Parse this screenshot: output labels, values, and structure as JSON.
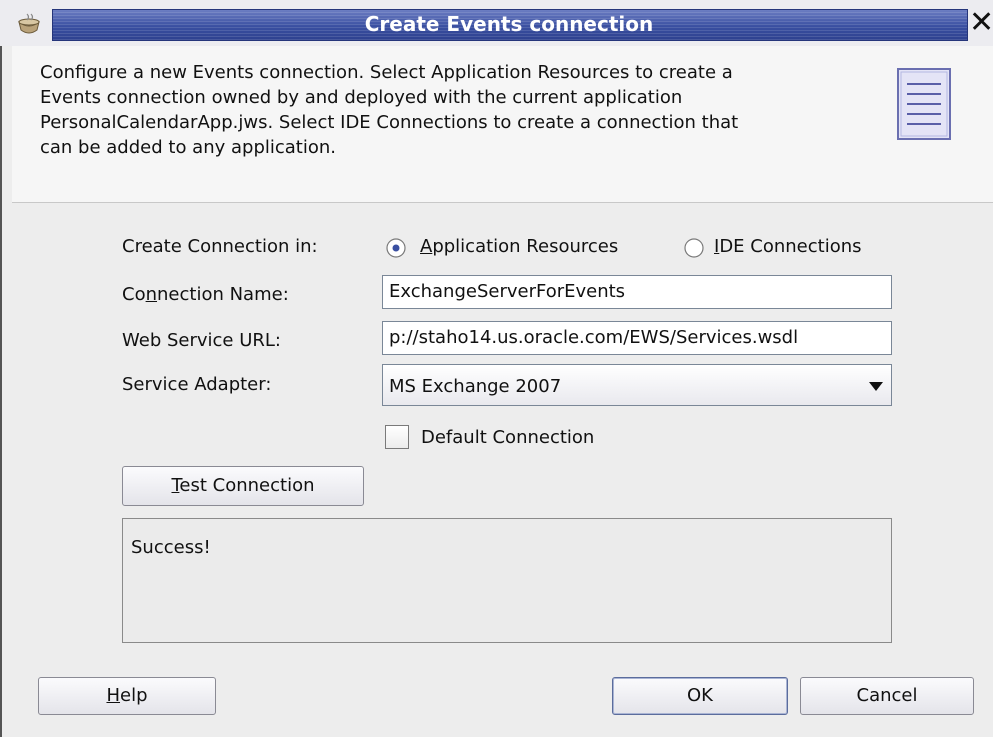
{
  "window": {
    "title": "Create Events connection",
    "close_glyph": "✕",
    "title_color": "#3a4fa1"
  },
  "header": {
    "description_lines": [
      "Configure a new Events connection. Select Application Resources to create a",
      "Events connection owned by and deployed with the current application",
      "PersonalCalendarApp.jws. Select IDE Connections to create a connection that",
      "can be added to any application."
    ],
    "icon": "document-icon"
  },
  "form": {
    "create_in_label": "Create Connection in:",
    "options": [
      {
        "label_rest": "pplication Resources",
        "mnemonic": "A",
        "selected": true
      },
      {
        "label_rest": "DE Connections",
        "mnemonic": "I",
        "selected": false
      }
    ],
    "connection_name": {
      "label_pre": "Co",
      "mnemonic": "n",
      "label_post": "nection Name:",
      "value": "ExchangeServerForEvents"
    },
    "url": {
      "label": "Web Service URL:",
      "value": "p://staho14.us.oracle.com/EWS/Services.wsdl"
    },
    "adapter": {
      "label": "Service Adapter:",
      "value": "MS Exchange 2007"
    },
    "default_connection": {
      "label": "Default Connection",
      "checked": false
    }
  },
  "test": {
    "button_mnemonic": "T",
    "button_rest": "est Connection",
    "result": "Success!"
  },
  "footer": {
    "help_mnemonic": "H",
    "help_rest": "elp",
    "ok": "OK",
    "cancel": "Cancel"
  }
}
